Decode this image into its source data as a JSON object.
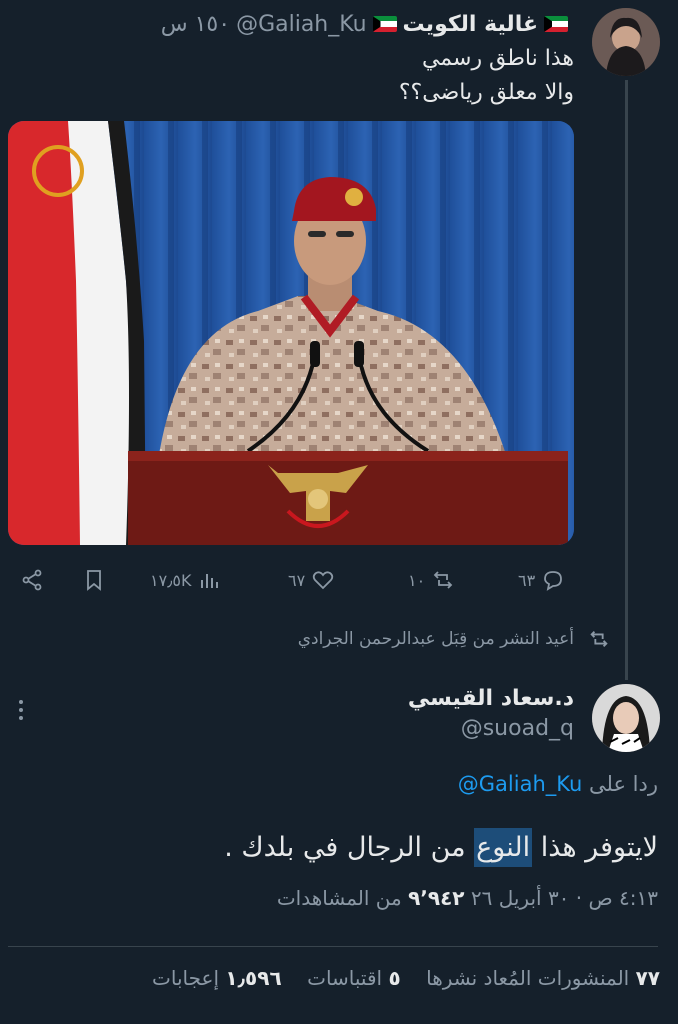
{
  "tweet1": {
    "name": "غالية الكويت",
    "handle": "@Galiah_Ku",
    "time": "١٥٠ س",
    "lines": [
      "هذا ناطق رسمي",
      "والا معلق رياضى؟؟"
    ],
    "actions": {
      "replies": "٦٣",
      "retweets": "١٠",
      "likes": "٦٧",
      "views": "١٧٫٥K"
    }
  },
  "retweeted_by": "أعيد النشر من قِبَل عبدالرحمن الجرادي",
  "tweet2": {
    "name": "د.سعاد القيسي",
    "handle": "@suoad_q",
    "replying_prefix": "ردا على",
    "replying_to": "@Galiah_Ku",
    "text_before": "لايتوفر هذا ",
    "text_highlight": "النوع",
    "text_after": " من الرجال في بلدك .",
    "time": "٤:١٣ ص · ٣٠ أبريل ٢٦",
    "views_count": "٩٬٩٤٢",
    "views_label": "من المشاهدات",
    "stats": {
      "retweets_count": "٧٧",
      "retweets_label": "المنشورات المُعاد نشرها",
      "quotes_count": "٥",
      "quotes_label": "اقتباسات",
      "likes_count": "١٫٥٩٦",
      "likes_label": "إعجابات"
    }
  },
  "colors": {
    "background": "#15202b",
    "accent": "#1d9bf0",
    "muted": "#8b98a5",
    "highlight": "#1d4d79"
  }
}
